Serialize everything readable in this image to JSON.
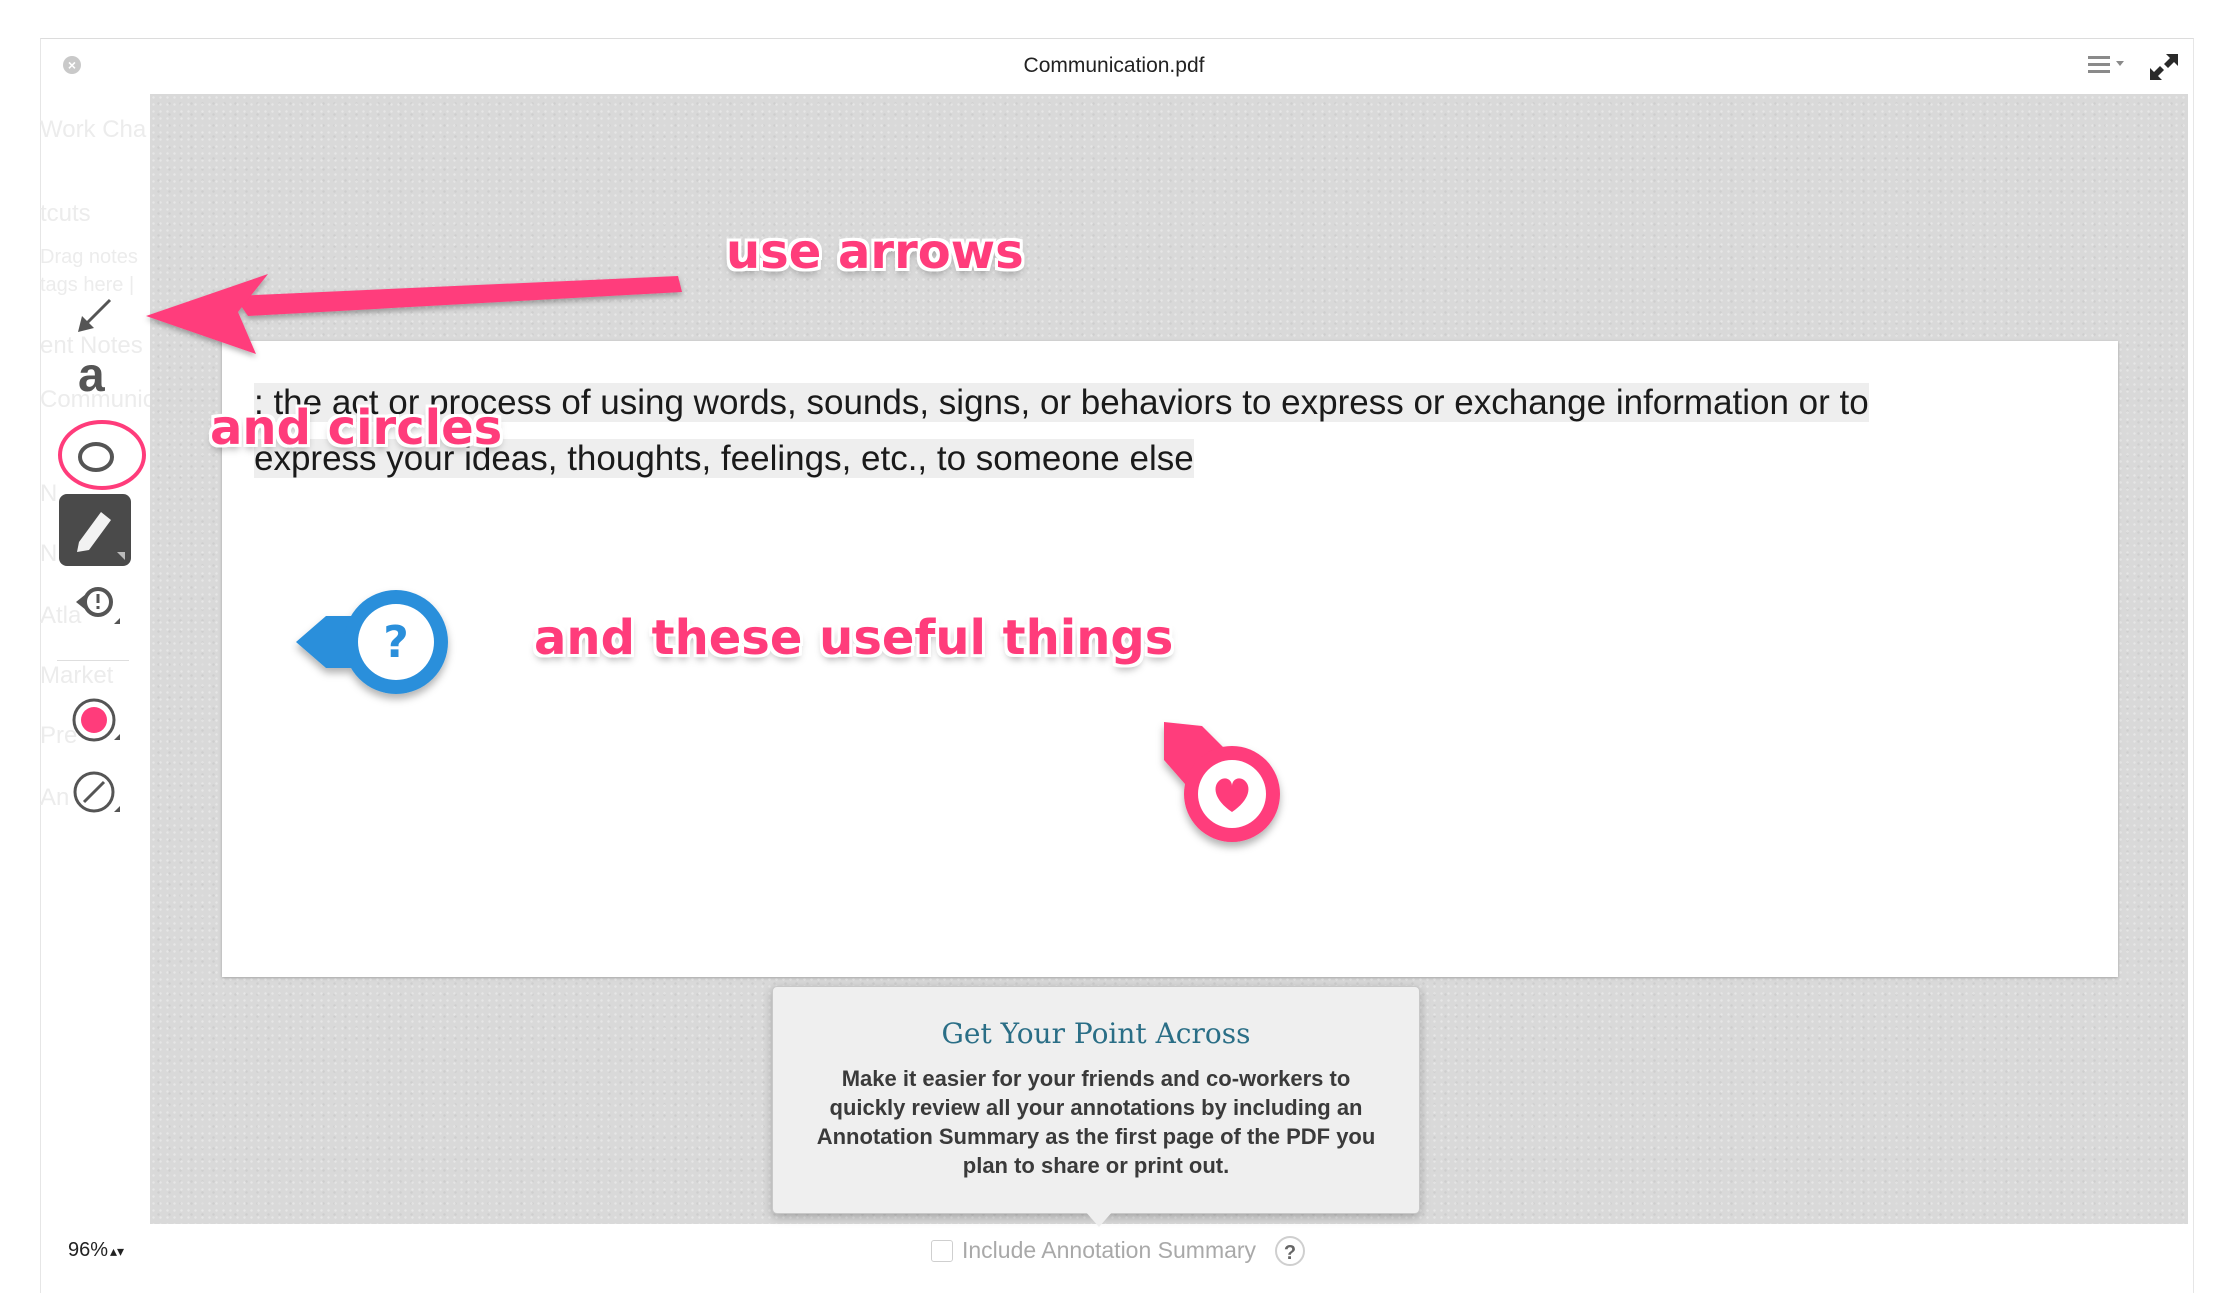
{
  "window": {
    "title": "Communication.pdf",
    "close_icon": "close-circle-icon",
    "menu_icon": "list-menu-icon",
    "expand_icon": "fullscreen-expand-icon"
  },
  "background_ghost_text": [
    "Work Cha",
    "tcuts",
    "Drag notes",
    "tags here |",
    "ent Notes",
    "Communic",
    "N",
    "N",
    "Atla",
    "Market",
    "Pre",
    "An"
  ],
  "toolbar": {
    "tools": [
      {
        "name": "arrow-tool",
        "icon": "arrow-icon"
      },
      {
        "name": "text-tool",
        "icon": "text-a-icon",
        "label": "a"
      },
      {
        "name": "shape-tool",
        "icon": "ellipse-icon"
      },
      {
        "name": "highlighter-tool",
        "icon": "highlighter-icon",
        "selected": true
      },
      {
        "name": "stamp-tool",
        "icon": "callout-stamp-icon"
      },
      {
        "name": "color-picker",
        "icon": "color-dot-icon",
        "color": "#ff3c7b"
      },
      {
        "name": "line-width-picker",
        "icon": "slash-circle-icon"
      }
    ]
  },
  "document": {
    "definition": [
      ": the act or process of using words, sounds, signs, or behaviors to express or exchange information or to",
      "express your ideas, thoughts, feelings, etc., to someone else"
    ]
  },
  "annotations": {
    "arrows_label": "use arrows",
    "circles_label": "and circles",
    "things_label": "and these useful things",
    "question_stamp": "?",
    "accent_color": "#ff3c7b",
    "stamp_blue": "#2a8fdb"
  },
  "popover": {
    "title": "Get Your Point Across",
    "body": "Make it easier for your friends and co-workers to quickly review all your annotations by including an Annotation Summary as the first page of the PDF you plan to share or print out."
  },
  "footer": {
    "zoom": "96%",
    "summary_label": "Include Annotation Summary",
    "summary_checked": false,
    "help_label": "?"
  }
}
